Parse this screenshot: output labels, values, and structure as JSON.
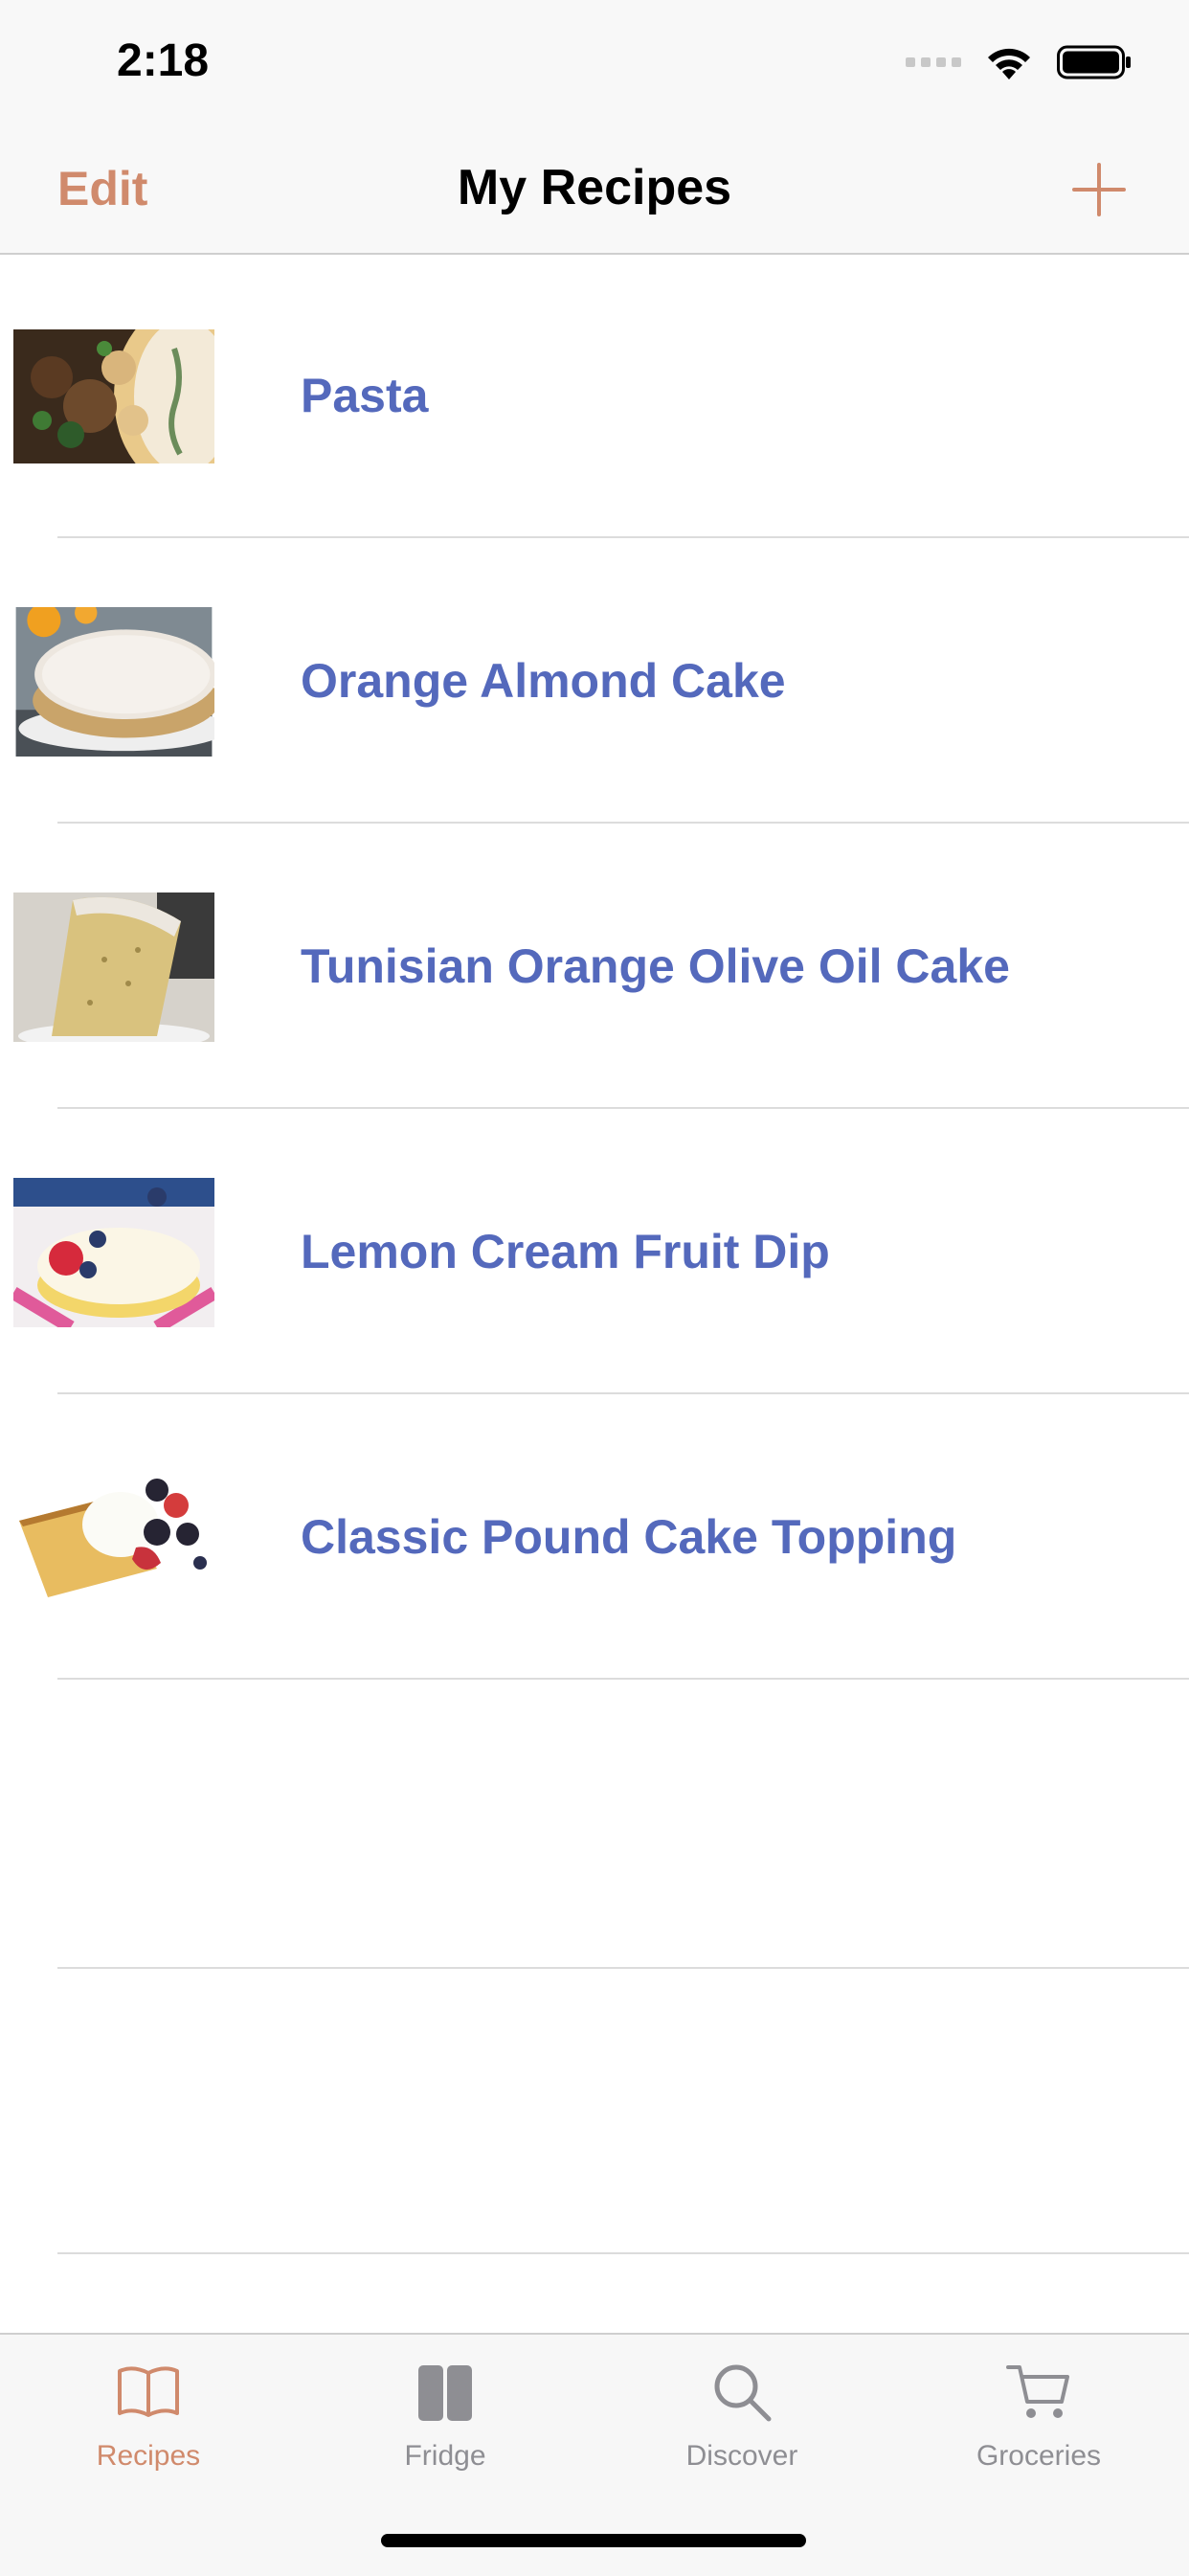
{
  "status_bar": {
    "time": "2:18"
  },
  "nav": {
    "edit_label": "Edit",
    "title": "My Recipes",
    "add_icon": "plus-icon"
  },
  "recipes": [
    {
      "name": "Pasta",
      "thumb": "pasta-photo"
    },
    {
      "name": "Orange Almond Cake",
      "thumb": "cake-photo"
    },
    {
      "name": "Tunisian Orange Olive Oil Cake",
      "thumb": "bundt-cake-photo"
    },
    {
      "name": "Lemon Cream Fruit Dip",
      "thumb": "fruit-dip-photo"
    },
    {
      "name": "Classic Pound Cake Topping",
      "thumb": "pound-cake-photo"
    }
  ],
  "tabs": [
    {
      "label": "Recipes",
      "icon": "book-icon",
      "active": true
    },
    {
      "label": "Fridge",
      "icon": "fridge-icon",
      "active": false
    },
    {
      "label": "Discover",
      "icon": "search-icon",
      "active": false
    },
    {
      "label": "Groceries",
      "icon": "cart-icon",
      "active": false
    }
  ],
  "colors": {
    "accent": "#d08a6c",
    "link": "#5469bc",
    "inactive": "#8e8e93"
  }
}
